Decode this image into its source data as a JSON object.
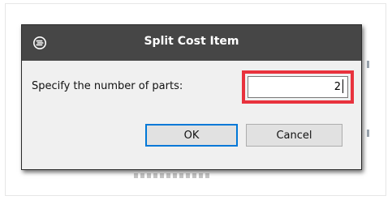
{
  "dialog": {
    "title": "Split Cost Item",
    "icon": "app-logo-icon",
    "prompt_label": "Specify the number of parts:",
    "parts_value": "2",
    "ok_label": "OK",
    "cancel_label": "Cancel"
  },
  "colors": {
    "titlebar": "#464646",
    "dialog_background": "#f0f0f0",
    "input_highlight": "#e8323d",
    "default_button_border": "#0078d7"
  }
}
